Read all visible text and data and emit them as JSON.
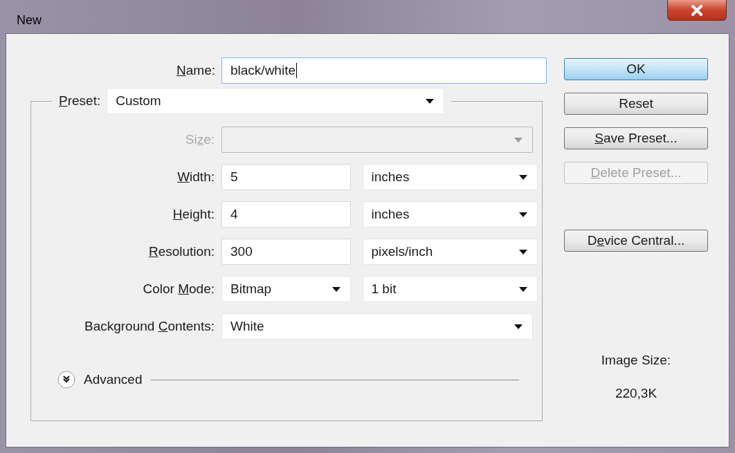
{
  "window": {
    "title": "New"
  },
  "name_field": {
    "label": {
      "key": "N",
      "after": "ame:"
    },
    "value": "black/white",
    "focused": true
  },
  "preset": {
    "label": {
      "key": "P",
      "after": "reset:"
    },
    "value": "Custom"
  },
  "rows": [
    {
      "label": {
        "before": "Si",
        "key": "z",
        "after": "e:"
      },
      "disabled": true,
      "controls": [
        {
          "kind": "select",
          "wide": true,
          "disabled": true
        }
      ]
    },
    {
      "label": {
        "key": "W",
        "after": "idth:"
      },
      "disabled": false,
      "controls": [
        {
          "kind": "input",
          "value": "5",
          "disabled": false
        },
        {
          "kind": "select",
          "value": "inches",
          "disabled": false
        }
      ]
    },
    {
      "label": {
        "key": "H",
        "after": "eight:"
      },
      "disabled": false,
      "controls": [
        {
          "kind": "input",
          "value": "4",
          "disabled": false
        },
        {
          "kind": "select",
          "value": "inches",
          "disabled": false
        }
      ]
    },
    {
      "label": {
        "key": "R",
        "after": "esolution:"
      },
      "disabled": false,
      "controls": [
        {
          "kind": "input",
          "value": "300",
          "disabled": false
        },
        {
          "kind": "select",
          "value": "pixels/inch",
          "disabled": false
        }
      ]
    },
    {
      "label": {
        "before": "Color ",
        "key": "M",
        "after": "ode:"
      },
      "disabled": false,
      "controls": [
        {
          "kind": "select",
          "value": "Bitmap",
          "disabled": false
        },
        {
          "kind": "select",
          "value": "1 bit",
          "disabled": false
        }
      ]
    },
    {
      "label": {
        "before": "Background ",
        "key": "C",
        "after": "ontents:"
      },
      "disabled": false,
      "controls": [
        {
          "kind": "select",
          "wide": true,
          "value": "White",
          "disabled": false
        }
      ]
    }
  ],
  "advanced": {
    "label": "Advanced",
    "expanded": false
  },
  "button_groups": [
    [
      {
        "label": {
          "after": "OK"
        },
        "default": true,
        "disabled": false
      },
      {
        "label": {
          "after": "Reset"
        },
        "default": false,
        "disabled": false
      },
      {
        "label": {
          "key": "S",
          "after": "ave Preset..."
        },
        "default": false,
        "disabled": false
      },
      {
        "label": {
          "key": "D",
          "after": "elete Preset..."
        },
        "default": false,
        "disabled": true
      }
    ],
    [
      {
        "label": {
          "before": "D",
          "key": "e",
          "after": "vice Central..."
        },
        "default": false,
        "disabled": false
      }
    ]
  ],
  "image_size": {
    "label": "Image Size:",
    "value": "220,3K"
  }
}
